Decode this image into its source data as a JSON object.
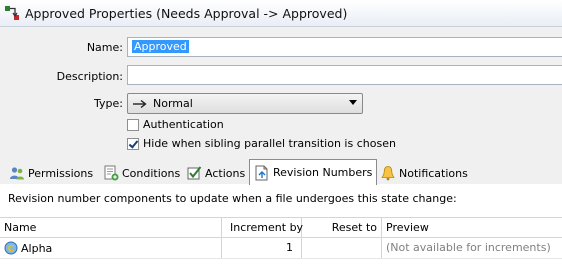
{
  "window": {
    "title": "Approved Properties (Needs Approval -> Approved)"
  },
  "form": {
    "name_label": "Name:",
    "name_value": "Approved",
    "description_label": "Description:",
    "description_value": "",
    "type_label": "Type:",
    "type_value": "Normal",
    "authentication_label": "Authentication",
    "authentication_checked": false,
    "hide_label": "Hide when sibling parallel transition is chosen",
    "hide_checked": true
  },
  "tabs": [
    {
      "label": "Permissions",
      "icon": "permissions-icon",
      "active": false
    },
    {
      "label": "Conditions",
      "icon": "conditions-icon",
      "active": false
    },
    {
      "label": "Actions",
      "icon": "actions-icon",
      "active": false
    },
    {
      "label": "Revision Numbers",
      "icon": "revision-numbers-icon",
      "active": true
    },
    {
      "label": "Notifications",
      "icon": "notifications-icon",
      "active": false
    }
  ],
  "panel": {
    "description": "Revision number components to update when a file undergoes this state change:",
    "columns": [
      "Name",
      "Increment by",
      "Reset to",
      "Preview"
    ],
    "rows": [
      {
        "name": "Alpha",
        "increment_by": "1",
        "reset_to": "",
        "preview": "(Not available for increments)"
      }
    ]
  }
}
